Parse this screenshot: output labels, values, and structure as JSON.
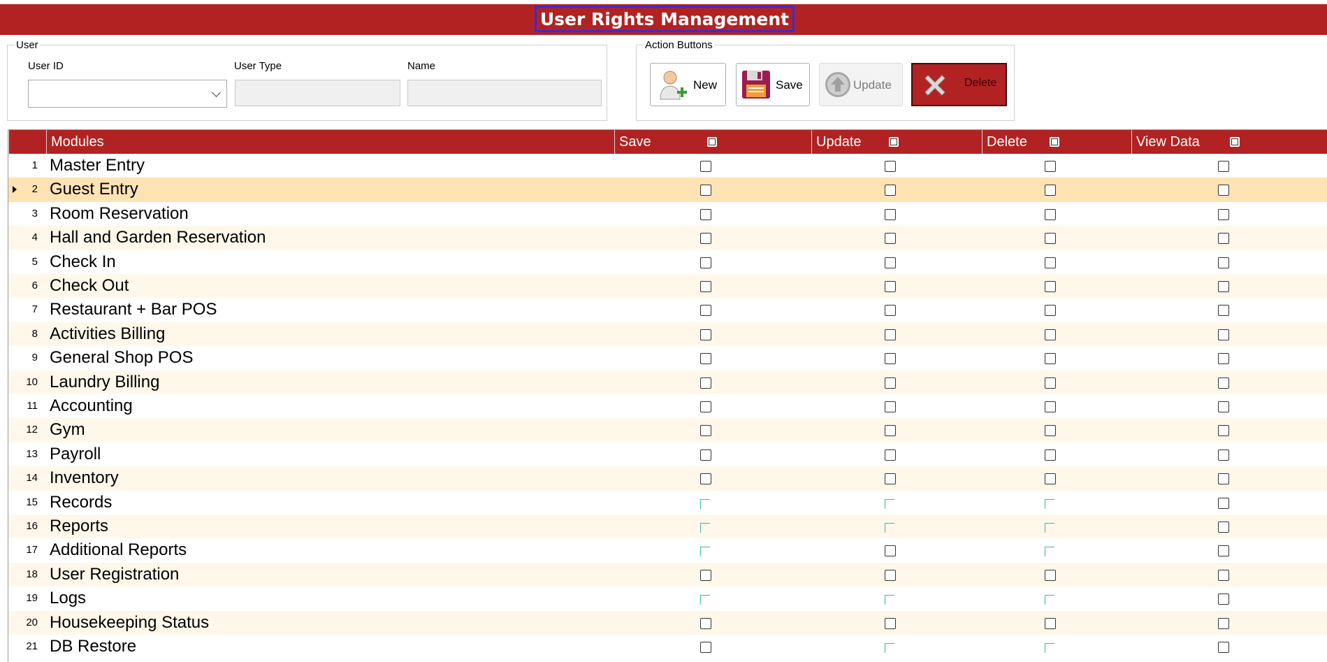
{
  "header": {
    "title": "User Rights Management"
  },
  "user_group": {
    "legend": "User",
    "user_id_label": "User ID",
    "user_type_label": "User Type",
    "name_label": "Name",
    "user_id_value": "",
    "user_type_value": "",
    "name_value": ""
  },
  "action_group": {
    "legend": "Action Buttons",
    "new_label": "New",
    "save_label": "Save",
    "update_label": "Update",
    "delete_label": "Delete"
  },
  "grid": {
    "columns": [
      "Modules",
      "Save",
      "Update",
      "Delete",
      "View Data"
    ],
    "rows": [
      {
        "num": "1",
        "module": "Master Entry",
        "save": "box",
        "update": "box",
        "delete": "box",
        "view": "box"
      },
      {
        "num": "2",
        "module": "Guest Entry",
        "save": "box",
        "update": "box",
        "delete": "box",
        "view": "box",
        "selected": true
      },
      {
        "num": "3",
        "module": "Room Reservation",
        "save": "box",
        "update": "box",
        "delete": "box",
        "view": "box"
      },
      {
        "num": "4",
        "module": "Hall and Garden Reservation",
        "save": "box",
        "update": "box",
        "delete": "box",
        "view": "box"
      },
      {
        "num": "5",
        "module": "Check In",
        "save": "box",
        "update": "box",
        "delete": "box",
        "view": "box"
      },
      {
        "num": "6",
        "module": "Check Out",
        "save": "box",
        "update": "box",
        "delete": "box",
        "view": "box"
      },
      {
        "num": "7",
        "module": "Restaurant + Bar POS",
        "save": "box",
        "update": "box",
        "delete": "box",
        "view": "box"
      },
      {
        "num": "8",
        "module": "Activities Billing",
        "save": "box",
        "update": "box",
        "delete": "box",
        "view": "box"
      },
      {
        "num": "9",
        "module": "General Shop POS",
        "save": "box",
        "update": "box",
        "delete": "box",
        "view": "box"
      },
      {
        "num": "10",
        "module": "Laundry Billing",
        "save": "box",
        "update": "box",
        "delete": "box",
        "view": "box"
      },
      {
        "num": "11",
        "module": "Accounting",
        "save": "box",
        "update": "box",
        "delete": "box",
        "view": "box"
      },
      {
        "num": "12",
        "module": "Gym",
        "save": "box",
        "update": "box",
        "delete": "box",
        "view": "box"
      },
      {
        "num": "13",
        "module": "Payroll",
        "save": "box",
        "update": "box",
        "delete": "box",
        "view": "box"
      },
      {
        "num": "14",
        "module": "Inventory",
        "save": "box",
        "update": "box",
        "delete": "box",
        "view": "box"
      },
      {
        "num": "15",
        "module": "Records",
        "save": "faded",
        "update": "faded",
        "delete": "faded",
        "view": "box"
      },
      {
        "num": "16",
        "module": "Reports",
        "save": "faded",
        "update": "faded",
        "delete": "faded",
        "view": "box"
      },
      {
        "num": "17",
        "module": "Additional Reports",
        "save": "faded",
        "update": "box",
        "delete": "faded",
        "view": "box"
      },
      {
        "num": "18",
        "module": "User Registration",
        "save": "box",
        "update": "box",
        "delete": "box",
        "view": "box"
      },
      {
        "num": "19",
        "module": "Logs",
        "save": "faded",
        "update": "faded",
        "delete": "faded",
        "view": "box"
      },
      {
        "num": "20",
        "module": "Housekeeping Status",
        "save": "box",
        "update": "box",
        "delete": "box",
        "view": "box"
      },
      {
        "num": "21",
        "module": "DB Restore",
        "save": "box",
        "update": "faded",
        "delete": "faded",
        "view": "box"
      }
    ]
  },
  "colors": {
    "brand_red": "#b22222",
    "selected_row": "#ffe3b5",
    "alt_row": "#fff7ea",
    "title_focus": "#3b2ad6"
  }
}
